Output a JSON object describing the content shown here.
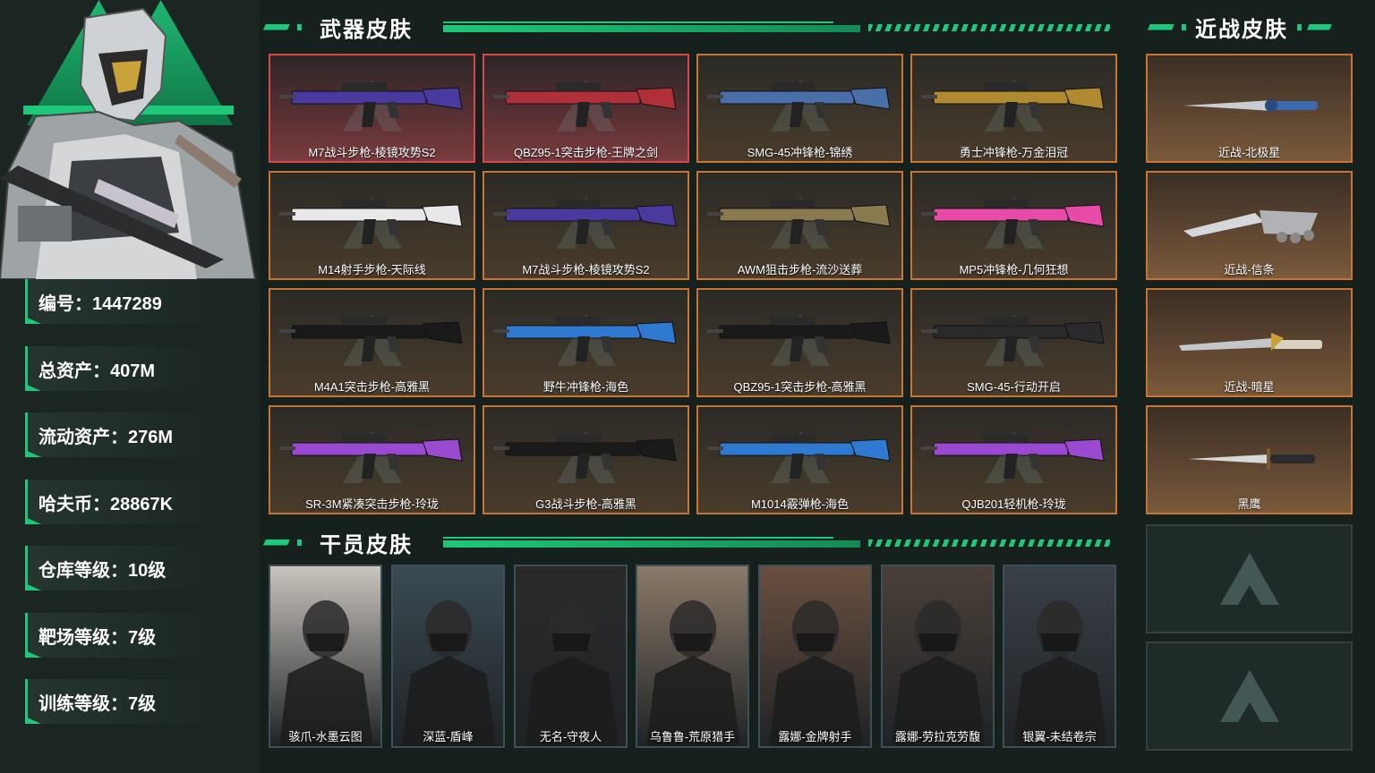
{
  "stats": [
    {
      "label": "编号：1447289"
    },
    {
      "label": "总资产：407M"
    },
    {
      "label": "流动资产：276M"
    },
    {
      "label": "哈夫币：28867K"
    },
    {
      "label": "仓库等级：10级"
    },
    {
      "label": "靶场等级：7级"
    },
    {
      "label": "训练等级：7级"
    }
  ],
  "sections": {
    "weapons": "武器皮肤",
    "melee": "近战皮肤",
    "operators": "干员皮肤"
  },
  "weapons": [
    {
      "name": "M7战斗步枪-棱镜攻势S2",
      "rarity": "red",
      "color": "#4a3aa0"
    },
    {
      "name": "QBZ95-1突击步枪-王牌之剑",
      "rarity": "red",
      "color": "#b0303a"
    },
    {
      "name": "SMG-45冲锋枪-锦绣",
      "rarity": "orange",
      "color": "#4a6fa8"
    },
    {
      "name": "勇士冲锋枪-万金泪冠",
      "rarity": "orange",
      "color": "#b08a30"
    },
    {
      "name": "M14射手步枪-天际线",
      "rarity": "orange",
      "color": "#e8e8e8"
    },
    {
      "name": "M7战斗步枪-棱镜攻势S2",
      "rarity": "orange",
      "color": "#4a3aa0"
    },
    {
      "name": "AWM狙击步枪-流沙送葬",
      "rarity": "orange",
      "color": "#8a7a50"
    },
    {
      "name": "MP5冲锋枪-几何狂想",
      "rarity": "orange",
      "color": "#e84aa8"
    },
    {
      "name": "M4A1突击步枪-高雅黑",
      "rarity": "orange",
      "color": "#1a1a1a"
    },
    {
      "name": "野牛冲锋枪-海色",
      "rarity": "orange",
      "color": "#2f7ad0"
    },
    {
      "name": "QBZ95-1突击步枪-高雅黑",
      "rarity": "orange",
      "color": "#1a1a1a"
    },
    {
      "name": "SMG-45-行动开启",
      "rarity": "orange",
      "color": "#2a2a2a"
    },
    {
      "name": "SR-3M紧凑突击步枪-玲珑",
      "rarity": "orange",
      "color": "#9a4ad0"
    },
    {
      "name": "G3战斗步枪-高雅黑",
      "rarity": "orange",
      "color": "#1a1a1a"
    },
    {
      "name": "M1014霰弹枪-海色",
      "rarity": "orange",
      "color": "#2f7ad0"
    },
    {
      "name": "QJB201轻机枪-玲珑",
      "rarity": "orange",
      "color": "#9a4ad0"
    }
  ],
  "melee": [
    {
      "name": "近战-北极星"
    },
    {
      "name": "近战-信条"
    },
    {
      "name": "近战-暗星"
    },
    {
      "name": "黑鹰"
    }
  ],
  "operators": [
    {
      "name": "骇爪-水墨云图",
      "bg": "#c9c3bd"
    },
    {
      "name": "深蓝-盾峰",
      "bg": "#3a4a52"
    },
    {
      "name": "无名-守夜人",
      "bg": "#2a2a2a"
    },
    {
      "name": "乌鲁鲁-荒原猎手",
      "bg": "#8a7a68"
    },
    {
      "name": "露娜-金牌射手",
      "bg": "#6a5040"
    },
    {
      "name": "露娜-劳拉克劳馥",
      "bg": "#4a4038"
    },
    {
      "name": "银翼-未结卷宗",
      "bg": "#3a4048"
    }
  ],
  "colors": {
    "accent": "#1fc77a",
    "orange_border": "#c97432",
    "red_border": "#d8474a"
  }
}
